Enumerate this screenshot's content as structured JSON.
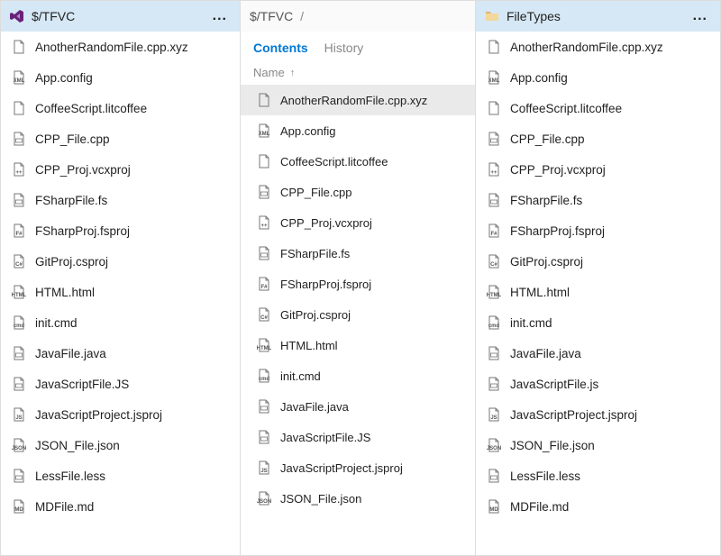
{
  "left": {
    "header": {
      "title": "$/TFVC",
      "more": "..."
    },
    "items": [
      {
        "icon": "file",
        "name": "AnotherRandomFile.cpp.xyz"
      },
      {
        "icon": "xml",
        "name": "App.config"
      },
      {
        "icon": "file",
        "name": "CoffeeScript.litcoffee"
      },
      {
        "icon": "cpp",
        "name": "CPP_File.cpp"
      },
      {
        "icon": "proj",
        "name": "CPP_Proj.vcxproj"
      },
      {
        "icon": "fs",
        "name": "FSharpFile.fs"
      },
      {
        "icon": "fsproj",
        "name": "FSharpProj.fsproj"
      },
      {
        "icon": "csproj",
        "name": "GitProj.csproj"
      },
      {
        "icon": "html",
        "name": "HTML.html"
      },
      {
        "icon": "cmd",
        "name": "init.cmd"
      },
      {
        "icon": "java",
        "name": "JavaFile.java"
      },
      {
        "icon": "js",
        "name": "JavaScriptFile.JS"
      },
      {
        "icon": "jsproj",
        "name": "JavaScriptProject.jsproj"
      },
      {
        "icon": "json",
        "name": "JSON_File.json"
      },
      {
        "icon": "less",
        "name": "LessFile.less"
      },
      {
        "icon": "md",
        "name": "MDFile.md"
      }
    ]
  },
  "middle": {
    "header": {
      "root": "$/TFVC",
      "sep": "/"
    },
    "tabs": {
      "contents": "Contents",
      "history": "History",
      "active": "contents"
    },
    "columnHeader": {
      "label": "Name",
      "sort": "asc"
    },
    "selectedIndex": 0,
    "items": [
      {
        "icon": "file",
        "name": "AnotherRandomFile.cpp.xyz"
      },
      {
        "icon": "xml",
        "name": "App.config"
      },
      {
        "icon": "file",
        "name": "CoffeeScript.litcoffee"
      },
      {
        "icon": "cpp",
        "name": "CPP_File.cpp"
      },
      {
        "icon": "proj",
        "name": "CPP_Proj.vcxproj"
      },
      {
        "icon": "fs",
        "name": "FSharpFile.fs"
      },
      {
        "icon": "fsproj",
        "name": "FSharpProj.fsproj"
      },
      {
        "icon": "csproj",
        "name": "GitProj.csproj"
      },
      {
        "icon": "html",
        "name": "HTML.html"
      },
      {
        "icon": "cmd",
        "name": "init.cmd"
      },
      {
        "icon": "java",
        "name": "JavaFile.java"
      },
      {
        "icon": "js",
        "name": "JavaScriptFile.JS"
      },
      {
        "icon": "jsproj",
        "name": "JavaScriptProject.jsproj"
      },
      {
        "icon": "json",
        "name": "JSON_File.json"
      }
    ]
  },
  "right": {
    "header": {
      "title": "FileTypes",
      "more": "..."
    },
    "items": [
      {
        "icon": "file",
        "name": "AnotherRandomFile.cpp.xyz"
      },
      {
        "icon": "xml",
        "name": "App.config"
      },
      {
        "icon": "file",
        "name": "CoffeeScript.litcoffee"
      },
      {
        "icon": "cpp",
        "name": "CPP_File.cpp"
      },
      {
        "icon": "proj",
        "name": "CPP_Proj.vcxproj"
      },
      {
        "icon": "fs",
        "name": "FSharpFile.fs"
      },
      {
        "icon": "fsproj",
        "name": "FSharpProj.fsproj"
      },
      {
        "icon": "csproj",
        "name": "GitProj.csproj"
      },
      {
        "icon": "html",
        "name": "HTML.html"
      },
      {
        "icon": "cmd",
        "name": "init.cmd"
      },
      {
        "icon": "java",
        "name": "JavaFile.java"
      },
      {
        "icon": "js",
        "name": "JavaScriptFile.js"
      },
      {
        "icon": "jsproj",
        "name": "JavaScriptProject.jsproj"
      },
      {
        "icon": "json",
        "name": "JSON_File.json"
      },
      {
        "icon": "less",
        "name": "LessFile.less"
      },
      {
        "icon": "md",
        "name": "MDFile.md"
      }
    ]
  },
  "iconBadges": {
    "xml": "XML",
    "cpp": "",
    "proj": "++",
    "fs": "",
    "fsproj": "F#",
    "csproj": "C#",
    "html": "HTML",
    "cmd": "cmd",
    "java": "",
    "js": "",
    "jsproj": "JS",
    "json": "JSON",
    "less": "",
    "md": "MD"
  }
}
